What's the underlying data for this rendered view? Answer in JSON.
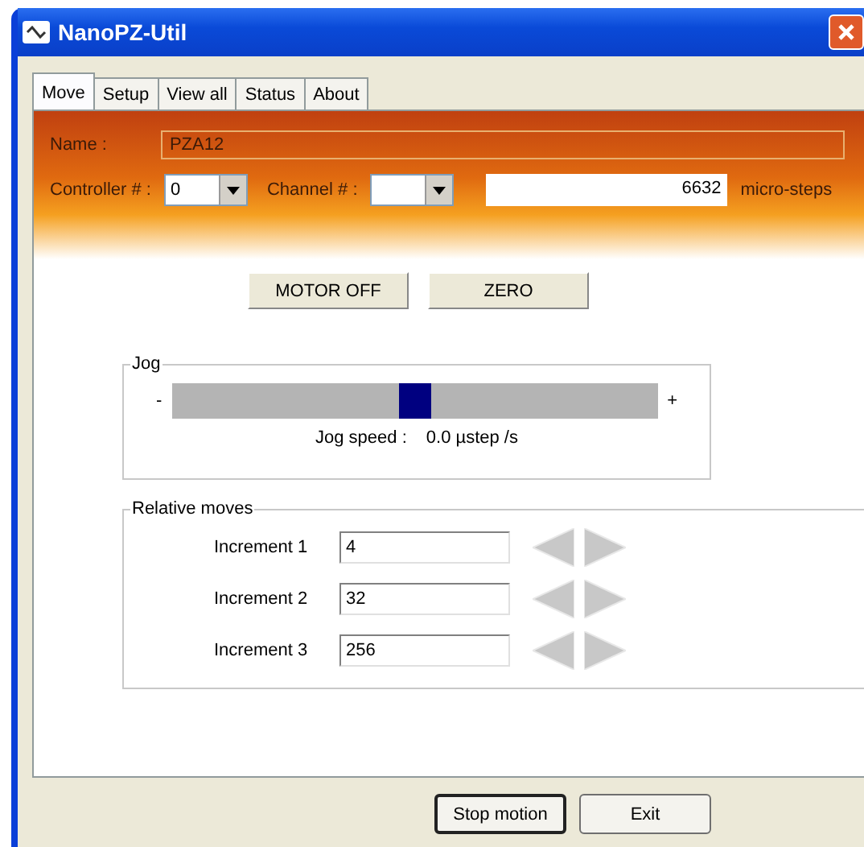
{
  "window": {
    "title": "NanoPZ-Util"
  },
  "tabs": [
    {
      "label": "Move",
      "selected": true
    },
    {
      "label": "Setup",
      "selected": false
    },
    {
      "label": "View all",
      "selected": false
    },
    {
      "label": "Status",
      "selected": false
    },
    {
      "label": "About",
      "selected": false
    }
  ],
  "name": {
    "label": "Name :",
    "value": "PZA12"
  },
  "controller": {
    "label": "Controller # :",
    "value": "0"
  },
  "channel": {
    "label": "Channel # :"
  },
  "position": {
    "value": "6632",
    "unit": "micro-steps"
  },
  "action_buttons": [
    "MOTOR OFF",
    "ZERO"
  ],
  "jog": {
    "title": "Jog",
    "minus": "-",
    "plus": "+",
    "level": 0.5,
    "speed_label": "Jog speed :",
    "speed": "0.0 µstep /s"
  },
  "relative_moves": {
    "title": "Relative moves",
    "rows": [
      {
        "label": "Increment 1",
        "value": "4"
      },
      {
        "label": "Increment 2",
        "value": "32"
      },
      {
        "label": "Increment 3",
        "value": "256"
      }
    ]
  },
  "footer_buttons": [
    {
      "label": "Stop motion",
      "default": true
    },
    {
      "label": "Exit",
      "default": false
    }
  ]
}
